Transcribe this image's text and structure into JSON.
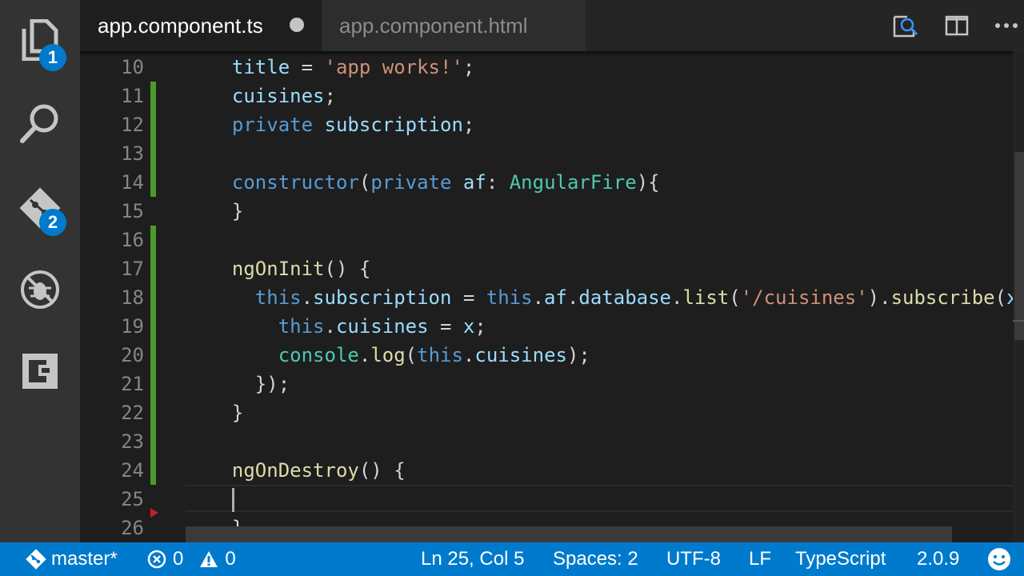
{
  "activity_bar": {
    "explorer_badge": "1",
    "scm_badge": "2"
  },
  "tabs": [
    {
      "label": "app.component.ts"
    },
    {
      "label": "app.component.html"
    }
  ],
  "editor": {
    "line_numbers": [
      "10",
      "11",
      "12",
      "13",
      "14",
      "15",
      "16",
      "17",
      "18",
      "19",
      "20",
      "21",
      "22",
      "23",
      "24",
      "25",
      "26"
    ],
    "lines": [
      [
        [
          "  ",
          "t-op"
        ],
        [
          "title",
          "t-var"
        ],
        [
          " = ",
          "t-op"
        ],
        [
          "'app works!'",
          "t-str"
        ],
        [
          ";",
          "t-op"
        ]
      ],
      [
        [
          "  ",
          "t-op"
        ],
        [
          "cuisines",
          "t-var"
        ],
        [
          ";",
          "t-op"
        ]
      ],
      [
        [
          "  ",
          "t-op"
        ],
        [
          "private",
          "t-kw"
        ],
        [
          " ",
          "t-op"
        ],
        [
          "subscription",
          "t-var"
        ],
        [
          ";",
          "t-op"
        ]
      ],
      [],
      [
        [
          "  ",
          "t-op"
        ],
        [
          "constructor",
          "t-kw"
        ],
        [
          "(",
          "t-op"
        ],
        [
          "private",
          "t-kw"
        ],
        [
          " ",
          "t-op"
        ],
        [
          "af",
          "t-var"
        ],
        [
          ": ",
          "t-op"
        ],
        [
          "AngularFire",
          "t-type"
        ],
        [
          "){",
          "t-op"
        ]
      ],
      [
        [
          "  ",
          "t-op"
        ],
        [
          "}",
          "t-op"
        ]
      ],
      [],
      [
        [
          "  ",
          "t-op"
        ],
        [
          "ngOnInit",
          "t-fn"
        ],
        [
          "() {",
          "t-op"
        ]
      ],
      [
        [
          "    ",
          "t-op"
        ],
        [
          "this",
          "t-kw"
        ],
        [
          ".",
          "t-op"
        ],
        [
          "subscription",
          "t-var"
        ],
        [
          " = ",
          "t-op"
        ],
        [
          "this",
          "t-kw"
        ],
        [
          ".",
          "t-op"
        ],
        [
          "af",
          "t-var"
        ],
        [
          ".",
          "t-op"
        ],
        [
          "database",
          "t-var"
        ],
        [
          ".",
          "t-op"
        ],
        [
          "list",
          "t-fn"
        ],
        [
          "(",
          "t-op"
        ],
        [
          "'/cuisines'",
          "t-str"
        ],
        [
          ").",
          "t-op"
        ],
        [
          "subscribe",
          "t-fn"
        ],
        [
          "(",
          "t-op"
        ],
        [
          "x",
          "t-var"
        ],
        [
          " =>",
          "t-kw"
        ]
      ],
      [
        [
          "      ",
          "t-op"
        ],
        [
          "this",
          "t-kw"
        ],
        [
          ".",
          "t-op"
        ],
        [
          "cuisines",
          "t-var"
        ],
        [
          " = ",
          "t-op"
        ],
        [
          "x",
          "t-var"
        ],
        [
          ";",
          "t-op"
        ]
      ],
      [
        [
          "      ",
          "t-op"
        ],
        [
          "console",
          "t-type"
        ],
        [
          ".",
          "t-op"
        ],
        [
          "log",
          "t-fn"
        ],
        [
          "(",
          "t-op"
        ],
        [
          "this",
          "t-kw"
        ],
        [
          ".",
          "t-op"
        ],
        [
          "cuisines",
          "t-var"
        ],
        [
          ");",
          "t-op"
        ]
      ],
      [
        [
          "    ",
          "t-op"
        ],
        [
          "});",
          "t-op"
        ]
      ],
      [
        [
          "  ",
          "t-op"
        ],
        [
          "}",
          "t-op"
        ]
      ],
      [],
      [
        [
          "  ",
          "t-op"
        ],
        [
          "ngOnDestroy",
          "t-fn"
        ],
        [
          "() {",
          "t-op"
        ]
      ],
      [],
      [
        [
          "  ",
          "t-op"
        ],
        [
          "}",
          "t-op"
        ]
      ]
    ]
  },
  "status_bar": {
    "branch": "master*",
    "errors": "0",
    "warnings": "0",
    "cursor_position": "Ln 25, Col 5",
    "indentation": "Spaces: 2",
    "encoding": "UTF-8",
    "line_ending": "LF",
    "language": "TypeScript",
    "version": "2.0.9"
  },
  "colors": {
    "accent": "#007acc",
    "git_added": "#4b9b2c",
    "git_deleted": "#c0202a"
  }
}
